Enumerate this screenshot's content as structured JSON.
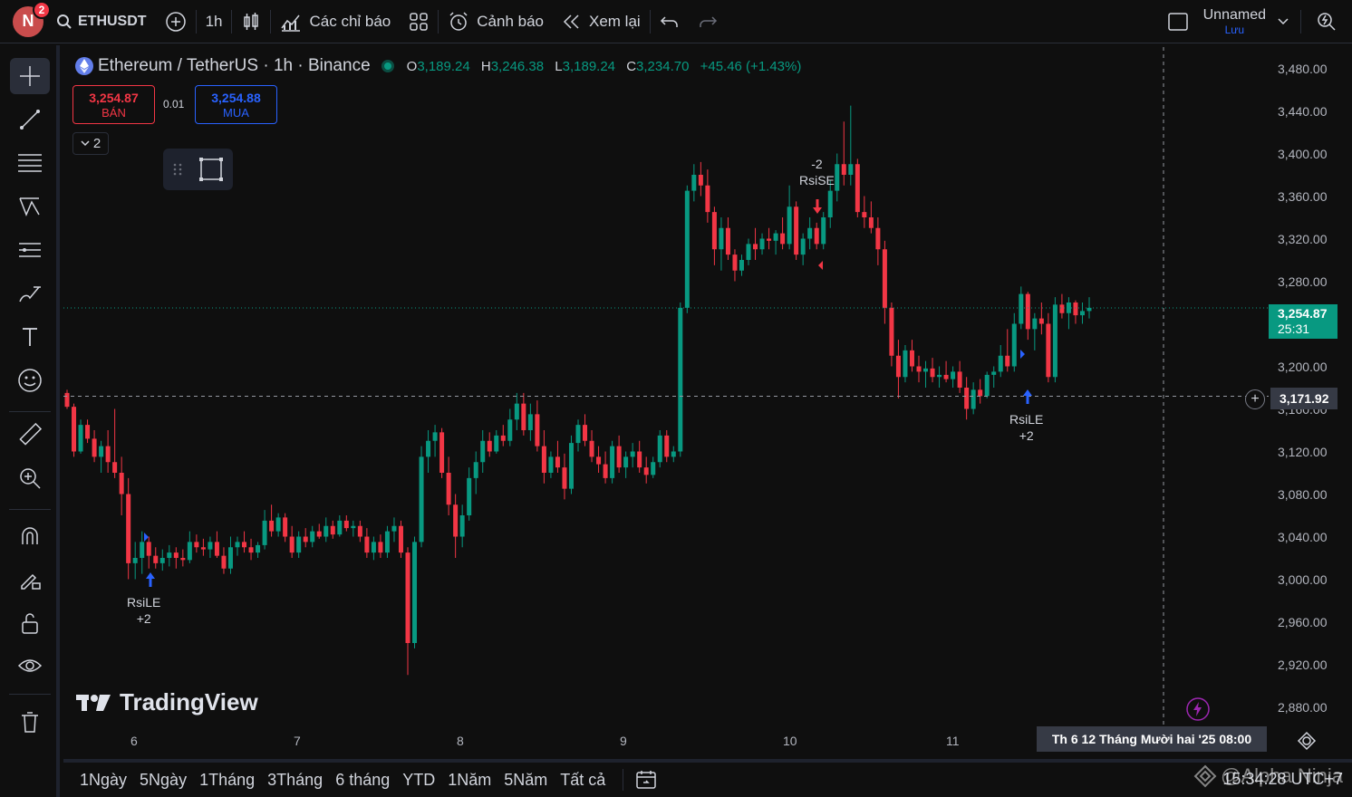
{
  "topbar": {
    "avatar_letter": "N",
    "notification_count": "2",
    "symbol": "ETHUSDT",
    "interval": "1h",
    "indicators_label": "Các chỉ báo",
    "alerts_label": "Cảnh báo",
    "replay_label": "Xem lại",
    "layout_name": "Unnamed",
    "save_label": "Lưu"
  },
  "legend": {
    "title": "Ethereum / TetherUS · 1h · Binance",
    "o_key": "O",
    "o_val": "3,189.24",
    "h_key": "H",
    "h_val": "3,246.38",
    "l_key": "L",
    "l_val": "3,189.24",
    "c_key": "C",
    "c_val": "3,234.70",
    "change": "+45.46 (+1.43%)"
  },
  "trade": {
    "sell_price": "3,254.87",
    "sell_label": "BÁN",
    "spread": "0.01",
    "buy_price": "3,254.88",
    "buy_label": "MUA",
    "collapse_count": "2"
  },
  "watermark": "TradingView",
  "price_axis": [
    "3,480.00",
    "3,440.00",
    "3,400.00",
    "3,360.00",
    "3,320.00",
    "3,280.00",
    "3,240.00",
    "3,200.00",
    "3,160.00",
    "3,120.00",
    "3,080.00",
    "3,040.00",
    "3,000.00",
    "2,960.00",
    "2,920.00",
    "2,880.00"
  ],
  "time_axis": [
    "6",
    "7",
    "8",
    "9",
    "10",
    "11"
  ],
  "last_price": {
    "price": "3,254.87",
    "countdown": "25:31"
  },
  "crosshair": {
    "price": "3,171.92",
    "date": "Th 6 12 Tháng Mười hai '25   08:00"
  },
  "signals": [
    {
      "label": "RsiLE",
      "qty": "+2"
    },
    {
      "label": "RsiSE",
      "qty": "-2"
    },
    {
      "label": "RsiLE",
      "qty": "+2"
    }
  ],
  "ranges": [
    "1Ngày",
    "5Ngày",
    "1Tháng",
    "3Tháng",
    "6 tháng",
    "YTD",
    "1Năm",
    "5Năm",
    "Tất cả"
  ],
  "clock": "15:34:28 UTC+7",
  "corner_watermark": "@Alpha Ninja",
  "colors": {
    "up": "#089981",
    "down": "#f23645",
    "buy": "#2962ff",
    "bg": "#0f0f0f"
  },
  "chart_data": {
    "type": "candlestick",
    "y_range": [
      2860,
      3500
    ],
    "x_ticks": [
      "6",
      "7",
      "8",
      "9",
      "10",
      "11"
    ],
    "ohlc": [
      [
        3175,
        3178,
        3160,
        3162
      ],
      [
        3162,
        3165,
        3115,
        3120
      ],
      [
        3120,
        3150,
        3118,
        3145
      ],
      [
        3145,
        3150,
        3128,
        3132
      ],
      [
        3132,
        3140,
        3110,
        3115
      ],
      [
        3115,
        3130,
        3100,
        3125
      ],
      [
        3125,
        3140,
        3100,
        3110
      ],
      [
        3110,
        3160,
        3095,
        3100
      ],
      [
        3100,
        3115,
        3060,
        3080
      ],
      [
        3080,
        3095,
        3000,
        3015
      ],
      [
        3015,
        3035,
        3000,
        3020
      ],
      [
        3020,
        3045,
        3005,
        3035
      ],
      [
        3035,
        3040,
        3010,
        3022
      ],
      [
        3022,
        3030,
        3010,
        3015
      ],
      [
        3015,
        3028,
        3008,
        3020
      ],
      [
        3020,
        3032,
        3012,
        3025
      ],
      [
        3025,
        3030,
        3010,
        3020
      ],
      [
        3020,
        3028,
        3012,
        3018
      ],
      [
        3018,
        3045,
        3015,
        3035
      ],
      [
        3035,
        3042,
        3025,
        3030
      ],
      [
        3030,
        3038,
        3022,
        3028
      ],
      [
        3028,
        3040,
        3020,
        3035
      ],
      [
        3035,
        3045,
        3020,
        3022
      ],
      [
        3022,
        3030,
        3005,
        3010
      ],
      [
        3010,
        3040,
        3005,
        3030
      ],
      [
        3030,
        3040,
        3022,
        3035
      ],
      [
        3035,
        3045,
        3025,
        3030
      ],
      [
        3030,
        3038,
        3018,
        3025
      ],
      [
        3025,
        3035,
        3020,
        3032
      ],
      [
        3032,
        3065,
        3028,
        3055
      ],
      [
        3055,
        3070,
        3040,
        3045
      ],
      [
        3045,
        3062,
        3040,
        3058
      ],
      [
        3058,
        3062,
        3035,
        3040
      ],
      [
        3040,
        3050,
        3020,
        3025
      ],
      [
        3025,
        3045,
        3020,
        3040
      ],
      [
        3040,
        3048,
        3030,
        3035
      ],
      [
        3035,
        3050,
        3030,
        3045
      ],
      [
        3045,
        3052,
        3038,
        3040
      ],
      [
        3040,
        3058,
        3035,
        3050
      ],
      [
        3050,
        3055,
        3038,
        3042
      ],
      [
        3042,
        3060,
        3040,
        3055
      ],
      [
        3055,
        3060,
        3045,
        3048
      ],
      [
        3048,
        3055,
        3040,
        3050
      ],
      [
        3050,
        3055,
        3035,
        3040
      ],
      [
        3040,
        3048,
        3020,
        3025
      ],
      [
        3025,
        3040,
        3018,
        3035
      ],
      [
        3035,
        3042,
        3020,
        3025
      ],
      [
        3025,
        3050,
        3020,
        3045
      ],
      [
        3045,
        3058,
        3035,
        3050
      ],
      [
        3050,
        3055,
        3020,
        3025
      ],
      [
        3025,
        3030,
        2910,
        2940
      ],
      [
        2940,
        3040,
        2935,
        3035
      ],
      [
        3035,
        3125,
        3030,
        3115
      ],
      [
        3115,
        3140,
        3100,
        3130
      ],
      [
        3130,
        3145,
        3115,
        3138
      ],
      [
        3138,
        3142,
        3095,
        3100
      ],
      [
        3100,
        3115,
        3060,
        3070
      ],
      [
        3070,
        3080,
        3020,
        3040
      ],
      [
        3040,
        3070,
        3030,
        3060
      ],
      [
        3060,
        3105,
        3055,
        3095
      ],
      [
        3095,
        3120,
        3080,
        3110
      ],
      [
        3110,
        3140,
        3100,
        3130
      ],
      [
        3130,
        3138,
        3115,
        3120
      ],
      [
        3120,
        3140,
        3118,
        3135
      ],
      [
        3135,
        3145,
        3125,
        3130
      ],
      [
        3130,
        3160,
        3125,
        3150
      ],
      [
        3150,
        3175,
        3140,
        3165
      ],
      [
        3165,
        3175,
        3135,
        3140
      ],
      [
        3140,
        3165,
        3130,
        3155
      ],
      [
        3155,
        3168,
        3120,
        3125
      ],
      [
        3125,
        3140,
        3090,
        3100
      ],
      [
        3100,
        3120,
        3095,
        3115
      ],
      [
        3115,
        3130,
        3100,
        3105
      ],
      [
        3105,
        3118,
        3075,
        3085
      ],
      [
        3085,
        3135,
        3080,
        3128
      ],
      [
        3128,
        3150,
        3120,
        3145
      ],
      [
        3145,
        3155,
        3125,
        3130
      ],
      [
        3130,
        3140,
        3110,
        3115
      ],
      [
        3115,
        3125,
        3100,
        3108
      ],
      [
        3108,
        3120,
        3090,
        3095
      ],
      [
        3095,
        3130,
        3090,
        3125
      ],
      [
        3125,
        3135,
        3100,
        3105
      ],
      [
        3105,
        3120,
        3095,
        3115
      ],
      [
        3115,
        3128,
        3105,
        3120
      ],
      [
        3120,
        3130,
        3100,
        3105
      ],
      [
        3105,
        3115,
        3090,
        3098
      ],
      [
        3098,
        3115,
        3095,
        3110
      ],
      [
        3110,
        3140,
        3105,
        3135
      ],
      [
        3135,
        3140,
        3110,
        3115
      ],
      [
        3115,
        3125,
        3110,
        3120
      ],
      [
        3120,
        3260,
        3115,
        3255
      ],
      [
        3255,
        3370,
        3250,
        3365
      ],
      [
        3365,
        3390,
        3355,
        3380
      ],
      [
        3380,
        3392,
        3360,
        3370
      ],
      [
        3370,
        3385,
        3335,
        3345
      ],
      [
        3345,
        3350,
        3295,
        3310
      ],
      [
        3310,
        3340,
        3290,
        3330
      ],
      [
        3330,
        3340,
        3300,
        3305
      ],
      [
        3305,
        3310,
        3280,
        3290
      ],
      [
        3290,
        3305,
        3285,
        3300
      ],
      [
        3300,
        3320,
        3295,
        3315
      ],
      [
        3315,
        3330,
        3300,
        3310
      ],
      [
        3310,
        3325,
        3305,
        3320
      ],
      [
        3320,
        3330,
        3310,
        3318
      ],
      [
        3318,
        3328,
        3305,
        3325
      ],
      [
        3325,
        3340,
        3310,
        3315
      ],
      [
        3315,
        3370,
        3310,
        3350
      ],
      [
        3350,
        3355,
        3300,
        3305
      ],
      [
        3305,
        3325,
        3295,
        3320
      ],
      [
        3320,
        3340,
        3310,
        3330
      ],
      [
        3330,
        3335,
        3310,
        3315
      ],
      [
        3315,
        3345,
        3310,
        3340
      ],
      [
        3340,
        3375,
        3330,
        3365
      ],
      [
        3365,
        3400,
        3355,
        3390
      ],
      [
        3390,
        3430,
        3370,
        3380
      ],
      [
        3380,
        3445,
        3370,
        3390
      ],
      [
        3390,
        3395,
        3340,
        3345
      ],
      [
        3345,
        3360,
        3330,
        3340
      ],
      [
        3340,
        3355,
        3325,
        3330
      ],
      [
        3330,
        3340,
        3295,
        3310
      ],
      [
        3310,
        3318,
        3240,
        3255
      ],
      [
        3255,
        3260,
        3200,
        3210
      ],
      [
        3210,
        3225,
        3170,
        3190
      ],
      [
        3190,
        3220,
        3185,
        3215
      ],
      [
        3215,
        3225,
        3195,
        3200
      ],
      [
        3200,
        3210,
        3185,
        3195
      ],
      [
        3195,
        3205,
        3180,
        3198
      ],
      [
        3198,
        3208,
        3185,
        3190
      ],
      [
        3190,
        3200,
        3180,
        3192
      ],
      [
        3192,
        3205,
        3185,
        3188
      ],
      [
        3188,
        3200,
        3180,
        3195
      ],
      [
        3195,
        3205,
        3175,
        3180
      ],
      [
        3180,
        3190,
        3150,
        3160
      ],
      [
        3160,
        3185,
        3155,
        3178
      ],
      [
        3178,
        3188,
        3165,
        3172
      ],
      [
        3172,
        3195,
        3170,
        3192
      ],
      [
        3192,
        3200,
        3180,
        3195
      ],
      [
        3195,
        3220,
        3190,
        3210
      ],
      [
        3210,
        3235,
        3195,
        3200
      ],
      [
        3200,
        3250,
        3195,
        3240
      ],
      [
        3240,
        3275,
        3235,
        3268
      ],
      [
        3268,
        3270,
        3225,
        3235
      ],
      [
        3235,
        3250,
        3215,
        3245
      ],
      [
        3245,
        3260,
        3230,
        3240
      ],
      [
        3240,
        3250,
        3185,
        3190
      ],
      [
        3190,
        3265,
        3185,
        3258
      ],
      [
        3258,
        3268,
        3245,
        3250
      ],
      [
        3250,
        3265,
        3235,
        3260
      ],
      [
        3260,
        3262,
        3240,
        3248
      ],
      [
        3248,
        3260,
        3240,
        3252
      ],
      [
        3252,
        3265,
        3245,
        3255
      ]
    ]
  }
}
